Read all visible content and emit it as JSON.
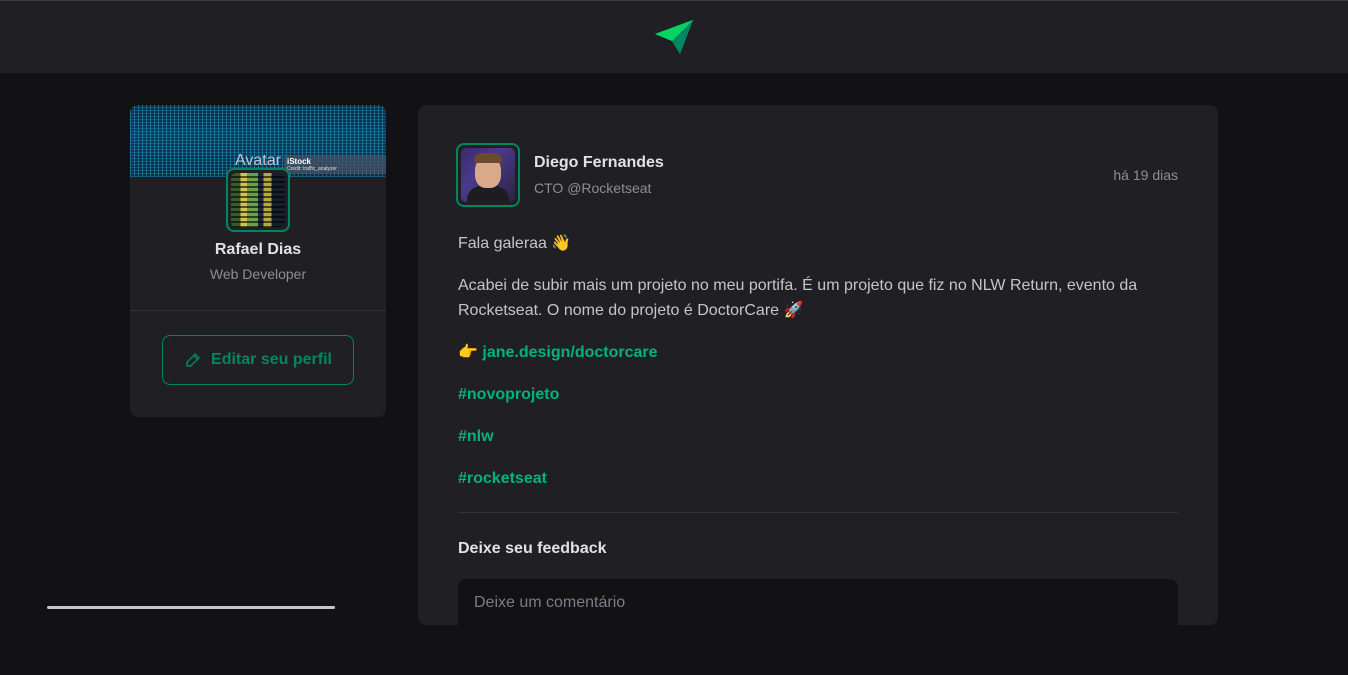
{
  "app": {
    "logo_icon": "paper-plane-logo",
    "accent": "#00875f",
    "link_color": "#00b37e",
    "background": "#121214",
    "surface": "#202024"
  },
  "sidebar": {
    "cover_alt": "Avatar",
    "cover_credit_brand": "iStock",
    "cover_credit_text": "Credit: traffic_analyzer",
    "name": "Rafael Dias",
    "role": "Web Developer",
    "edit_button_label": "Editar seu perfil",
    "edit_icon": "pencil-icon"
  },
  "post": {
    "author_name": "Diego Fernandes",
    "author_role": "CTO @Rocketseat",
    "published": "há 19 dias",
    "paragraphs": [
      "Fala galeraa 👋",
      "Acabei de subir mais um projeto no meu portifa. É um projeto que fiz no NLW Return, evento da Rocketseat. O nome do projeto é DoctorCare 🚀"
    ],
    "link_prefix": "👉 ",
    "link_text": "jane.design/doctorcare",
    "hashtags": [
      "#novoprojeto",
      "#nlw",
      "#rocketseat"
    ],
    "feedback_title": "Deixe seu feedback",
    "comment_placeholder": "Deixe um comentário"
  }
}
